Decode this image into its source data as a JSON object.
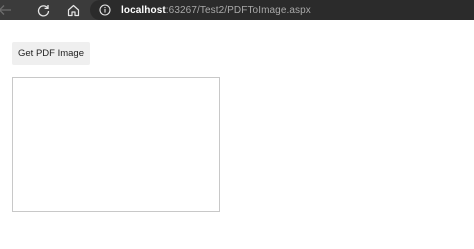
{
  "browser": {
    "url_host": "localhost",
    "url_rest": ":63267/Test2/PDFToImage.aspx",
    "icons": {
      "back": "back-arrow-icon",
      "reload": "reload-icon",
      "home": "home-icon",
      "info": "info-icon"
    }
  },
  "page": {
    "get_pdf_button_label": "Get PDF Image"
  }
}
